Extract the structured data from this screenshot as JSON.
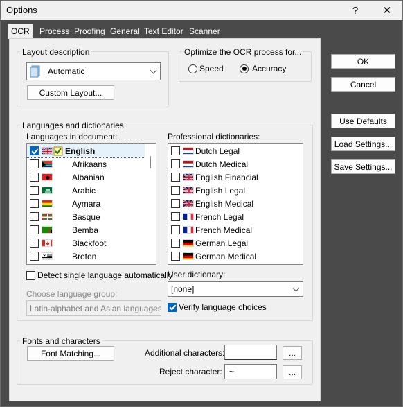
{
  "window": {
    "title": "Options",
    "help_label": "?",
    "close_label": "✕"
  },
  "tabs": [
    "OCR",
    "Process",
    "Proofing",
    "General",
    "Text Editor",
    "Scanner"
  ],
  "layout": {
    "group_label": "Layout description",
    "combo_value": "Automatic",
    "combo_icon": "document-icon",
    "custom_button": "Custom Layout..."
  },
  "optimize": {
    "group_label": "Optimize the OCR process for...",
    "speed_label": "Speed",
    "accuracy_label": "Accuracy",
    "selected": "Accuracy"
  },
  "languages": {
    "group_label": "Languages and dictionaries",
    "doc_label": "Languages in document:",
    "doc_items": [
      {
        "label": "English",
        "checked": true,
        "flag": "uk",
        "bold": true,
        "verified": true
      },
      {
        "label": "Afrikaans",
        "checked": false,
        "flag": "za"
      },
      {
        "label": "Albanian",
        "checked": false,
        "flag": "al"
      },
      {
        "label": "Arabic",
        "checked": false,
        "flag": "sa"
      },
      {
        "label": "Aymara",
        "checked": false,
        "flag": "bo"
      },
      {
        "label": "Basque",
        "checked": false,
        "flag": "eus"
      },
      {
        "label": "Bemba",
        "checked": false,
        "flag": "zm"
      },
      {
        "label": "Blackfoot",
        "checked": false,
        "flag": "ca"
      },
      {
        "label": "Breton",
        "checked": false,
        "flag": "bzh"
      }
    ],
    "pro_label": "Professional dictionaries:",
    "pro_items": [
      {
        "label": "Dutch Legal",
        "checked": false,
        "flag": "nl"
      },
      {
        "label": "Dutch Medical",
        "checked": false,
        "flag": "nl"
      },
      {
        "label": "English Financial",
        "checked": false,
        "flag": "uk"
      },
      {
        "label": "English Legal",
        "checked": false,
        "flag": "uk"
      },
      {
        "label": "English Medical",
        "checked": false,
        "flag": "uk"
      },
      {
        "label": "French Legal",
        "checked": false,
        "flag": "fr"
      },
      {
        "label": "French Medical",
        "checked": false,
        "flag": "fr"
      },
      {
        "label": "German Legal",
        "checked": false,
        "flag": "de"
      },
      {
        "label": "German Medical",
        "checked": false,
        "flag": "de"
      }
    ],
    "detect_label": "Detect single language automatically",
    "detect_checked": false,
    "group_choose_label": "Choose language group:",
    "group_choose_value": "Latin-alphabet and Asian languages",
    "user_dict_label": "User dictionary:",
    "user_dict_value": "[none]",
    "verify_label": "Verify language choices",
    "verify_checked": true
  },
  "fonts": {
    "group_label": "Fonts and characters",
    "matching_button": "Font Matching...",
    "additional_label": "Additional characters:",
    "additional_value": "",
    "reject_label": "Reject character:",
    "reject_value": "~",
    "ellipsis": "..."
  },
  "side_buttons": {
    "ok": "OK",
    "cancel": "Cancel",
    "defaults": "Use Defaults",
    "load": "Load Settings...",
    "save": "Save Settings..."
  },
  "colors": {
    "accent": "#0067c0",
    "tab_strip": "#4a4a4a"
  }
}
